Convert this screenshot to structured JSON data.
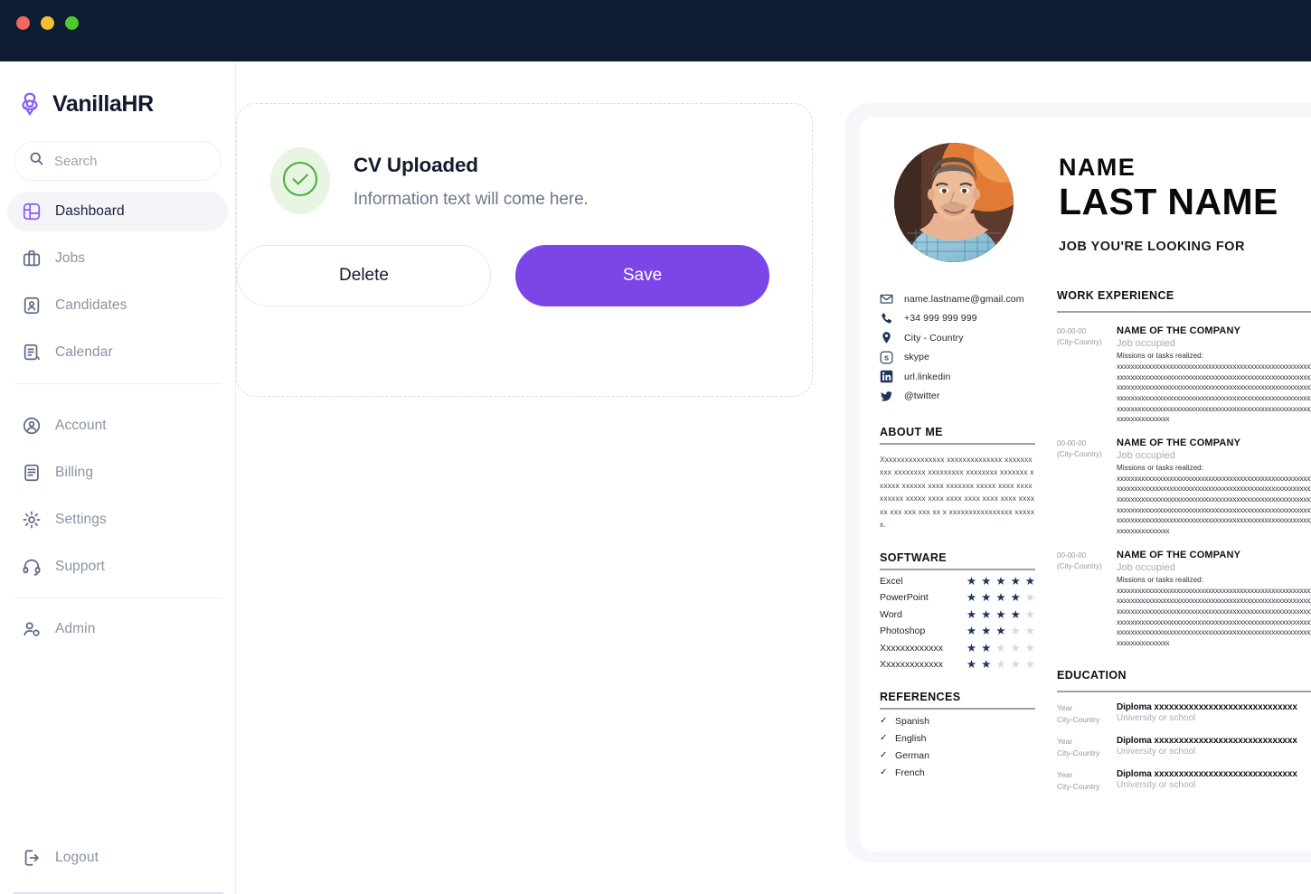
{
  "window": {
    "lights": [
      "close",
      "minimize",
      "zoom"
    ]
  },
  "sidebar": {
    "brand": "VanillaHR",
    "search": {
      "placeholder": "Search",
      "value": ""
    },
    "primary_items": [
      {
        "label": "Dashboard",
        "icon": "dashboard-icon",
        "active": true
      },
      {
        "label": "Jobs",
        "icon": "briefcase-icon",
        "active": false
      },
      {
        "label": "Candidates",
        "icon": "candidate-badge-icon",
        "active": false
      },
      {
        "label": "Calendar",
        "icon": "calendar-note-icon",
        "active": false
      }
    ],
    "secondary_items": [
      {
        "label": "Account",
        "icon": "user-circle-icon",
        "active": false
      },
      {
        "label": "Billing",
        "icon": "receipt-icon",
        "active": false
      },
      {
        "label": "Settings",
        "icon": "gear-icon",
        "active": false
      },
      {
        "label": "Support",
        "icon": "headset-icon",
        "active": false
      }
    ],
    "admin_items": [
      {
        "label": "Admin",
        "icon": "user-shield-icon",
        "active": false
      }
    ],
    "logout": {
      "label": "Logout",
      "icon": "logout-icon"
    }
  },
  "upload_card": {
    "status_icon": "check-circle-icon",
    "title": "CV Uploaded",
    "subtitle": "Information text will come here.",
    "delete_label": "Delete",
    "save_label": "Save"
  },
  "cv": {
    "name": "NAME",
    "last_name": "LAST NAME",
    "job_title": "JOB YOU'RE LOOKING FOR",
    "photo_alt": "candidate-photo",
    "contacts": [
      {
        "icon": "envelope-icon",
        "text": "name.lastname@gmail.com"
      },
      {
        "icon": "phone-icon",
        "text": "+34 999 999 999"
      },
      {
        "icon": "location-pin-icon",
        "text": "City - Country"
      },
      {
        "icon": "skype-icon",
        "text": "skype"
      },
      {
        "icon": "linkedin-icon",
        "text": "url.linkedin"
      },
      {
        "icon": "twitter-icon",
        "text": "@twitter"
      }
    ],
    "about": {
      "title": "ABOUT ME",
      "text": "Xxxxxxxxxxxxxxxx xxxxxxxxxxxxxx xxxxxxxxxx xxxxxxxx xxxxxxxxx xxxxxxxx xxxxxxx xxxxxx xxxxxx xxxx xxxxxxx xxxxx xxxx xxxx xxxxxx xxxxx xxxx xxxx xxxx xxxx xxxx xxxx xx xxx xxx xxx xx x xxxxxxxxxxxxxxxx xxxxxx."
    },
    "software": {
      "title": "SOFTWARE",
      "max_stars": 5,
      "items": [
        {
          "name": "Excel",
          "rating": 5
        },
        {
          "name": "PowerPoint",
          "rating": 4
        },
        {
          "name": "Word",
          "rating": 4
        },
        {
          "name": "Photoshop",
          "rating": 3
        },
        {
          "name": "Xxxxxxxxxxxxx",
          "rating": 2
        },
        {
          "name": "Xxxxxxxxxxxxx",
          "rating": 2
        }
      ]
    },
    "references": {
      "title": "REFERENCES",
      "check": "✓",
      "items": [
        {
          "name": "Spanish"
        },
        {
          "name": "English"
        },
        {
          "name": "German"
        },
        {
          "name": "French"
        }
      ]
    },
    "work_experience": {
      "title": "WORK EXPERIENCE",
      "items": [
        {
          "date": "00-00-00",
          "place": "(City-Country)",
          "company": "NAME OF THE COMPANY",
          "job": "Job occupied",
          "missions_label": "Missions or tasks realized:",
          "lines": [
            "xxxxxxxxxxxxxxxxxxxxxxxxxxxxxxxxxxxxxxxxxxxxxxxxxxxxxxxxxxxxxxxx",
            "xxxxxxxxxxxxxxxxxxxxxxxxxxxxxxxxxxxxxxxxxxxxxxxxxxxxxxxxxxxxxxxx",
            "xxxxxxxxxxxxxxxxxxxxxxxxxxxxxxxxxxxxxxxxxxxxxxxxxxxxxxxxxxxxxxxx",
            "xxxxxxxxxxxxxxxxxxxxxxxxxxxxxxxxxxxxxxxxxxxxxxxxxxxxxxxxxxxxxxxx",
            "xxxxxxxxxxxxxxxxxxxxxxxxxxxxxxxxxxxxxxxxxxxxxxxxxxxxxxxxxxxxxxxx",
            "xxxxxxxxxxxxxxx"
          ]
        },
        {
          "date": "00-00-00",
          "place": "(City-Country)",
          "company": "NAME OF THE COMPANY",
          "job": "Job occupied",
          "missions_label": "Missions or tasks realized:",
          "lines": [
            "xxxxxxxxxxxxxxxxxxxxxxxxxxxxxxxxxxxxxxxxxxxxxxxxxxxxxxxxxxxxxxxx",
            "xxxxxxxxxxxxxxxxxxxxxxxxxxxxxxxxxxxxxxxxxxxxxxxxxxxxxxxxxxxxxxxx",
            "xxxxxxxxxxxxxxxxxxxxxxxxxxxxxxxxxxxxxxxxxxxxxxxxxxxxxxxxxxxxxxxx",
            "xxxxxxxxxxxxxxxxxxxxxxxxxxxxxxxxxxxxxxxxxxxxxxxxxxxxxxxxxxxxxxxx",
            "xxxxxxxxxxxxxxxxxxxxxxxxxxxxxxxxxxxxxxxxxxxxxxxxxxxxxxxxxxxxxxxx",
            "xxxxxxxxxxxxxxx"
          ]
        },
        {
          "date": "00-00-00",
          "place": "(City-Country)",
          "company": "NAME OF THE COMPANY",
          "job": "Job occupied",
          "missions_label": "Missions or tasks realized:",
          "lines": [
            "xxxxxxxxxxxxxxxxxxxxxxxxxxxxxxxxxxxxxxxxxxxxxxxxxxxxxxxxxxxxxxxx",
            "xxxxxxxxxxxxxxxxxxxxxxxxxxxxxxxxxxxxxxxxxxxxxxxxxxxxxxxxxxxxxxxx",
            "xxxxxxxxxxxxxxxxxxxxxxxxxxxxxxxxxxxxxxxxxxxxxxxxxxxxxxxxxxxxxxxx",
            "xxxxxxxxxxxxxxxxxxxxxxxxxxxxxxxxxxxxxxxxxxxxxxxxxxxxxxxxxxxxxxxx",
            "xxxxxxxxxxxxxxxxxxxxxxxxxxxxxxxxxxxxxxxxxxxxxxxxxxxxxxxxxxxxxxxx",
            "xxxxxxxxxxxxxxx"
          ]
        }
      ]
    },
    "education": {
      "title": "EDUCATION",
      "items": [
        {
          "year": "Year",
          "place": "City-Country",
          "diploma": "Diploma xxxxxxxxxxxxxxxxxxxxxxxxxxxxx",
          "school": "University or school"
        },
        {
          "year": "Year",
          "place": "City-Country",
          "diploma": "Diploma xxxxxxxxxxxxxxxxxxxxxxxxxxxxx",
          "school": "University or school"
        },
        {
          "year": "Year",
          "place": "City-Country",
          "diploma": "Diploma xxxxxxxxxxxxxxxxxxxxxxxxxxxxx",
          "school": "University or school"
        }
      ]
    }
  },
  "colors": {
    "titlebar": "#0d1b33",
    "accent_purple": "#7c45e8",
    "logo_purple": "#8b5cf6",
    "success_green": "#4caf3f",
    "success_bg": "#e7f5e2",
    "cv_navy": "#1d3557",
    "panel_bg": "#f6f7fb"
  }
}
